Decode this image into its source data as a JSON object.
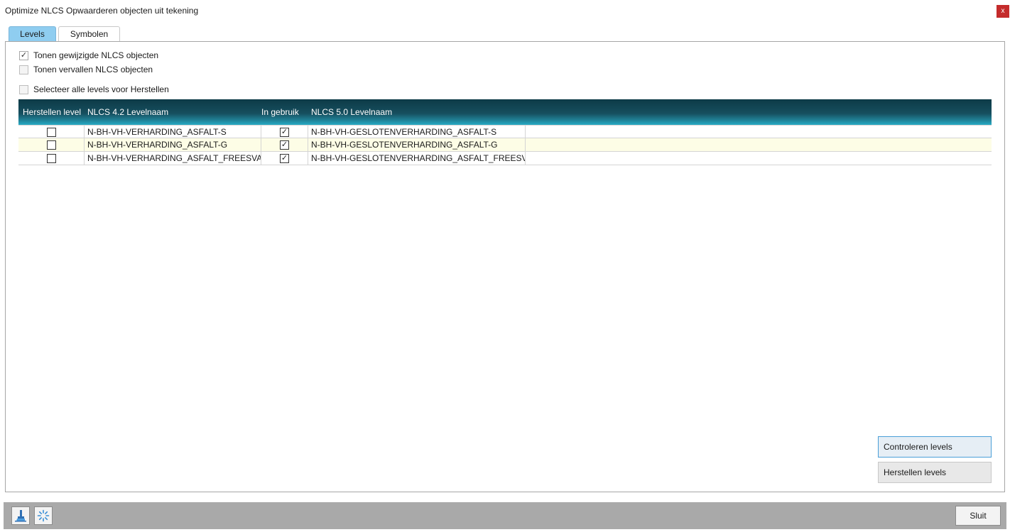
{
  "window": {
    "title": "Optimize NLCS Opwaarderen objecten uit tekening",
    "close_label": "x"
  },
  "tabs": [
    {
      "label": "Levels",
      "active": true
    },
    {
      "label": "Symbolen",
      "active": false
    }
  ],
  "options": {
    "show_changed": {
      "label": "Tonen gewijzigde NLCS objecten",
      "checked": true
    },
    "show_expired": {
      "label": "Tonen vervallen NLCS objecten",
      "checked": false
    },
    "select_all": {
      "label": "Selecteer alle levels voor Herstellen",
      "checked": false
    }
  },
  "grid": {
    "columns": [
      "Herstellen level",
      "NLCS 4.2 Levelnaam",
      "In gebruik",
      "NLCS 5.0 Levelnaam"
    ],
    "rows": [
      {
        "herstellen": false,
        "old_name": "N-BH-VH-VERHARDING_ASFALT-S",
        "in_gebruik": true,
        "new_name": "N-BH-VH-GESLOTENVERHARDING_ASFALT-S"
      },
      {
        "herstellen": false,
        "old_name": "N-BH-VH-VERHARDING_ASFALT-G",
        "in_gebruik": true,
        "new_name": "N-BH-VH-GESLOTENVERHARDING_ASFALT-G"
      },
      {
        "herstellen": false,
        "old_name": "N-BH-VH-VERHARDING_ASFALT_FREESVAK-G",
        "in_gebruik": true,
        "new_name": "N-BH-VH-GESLOTENVERHARDING_ASFALT_FREESVAK-G"
      }
    ]
  },
  "actions": {
    "check_label": "Controleren levels",
    "restore_label": "Herstellen levels"
  },
  "footer": {
    "close_label": "Sluit",
    "tool_icons": [
      "brush-icon",
      "loading-spinner-icon"
    ]
  },
  "colors": {
    "tab_active": "#8fcdf0",
    "header_dark": "#0d3a47",
    "header_light": "#27aac4",
    "alt_row": "#fdfde6",
    "close_red": "#c42b2b",
    "bottom_bar": "#a9a9a9"
  }
}
